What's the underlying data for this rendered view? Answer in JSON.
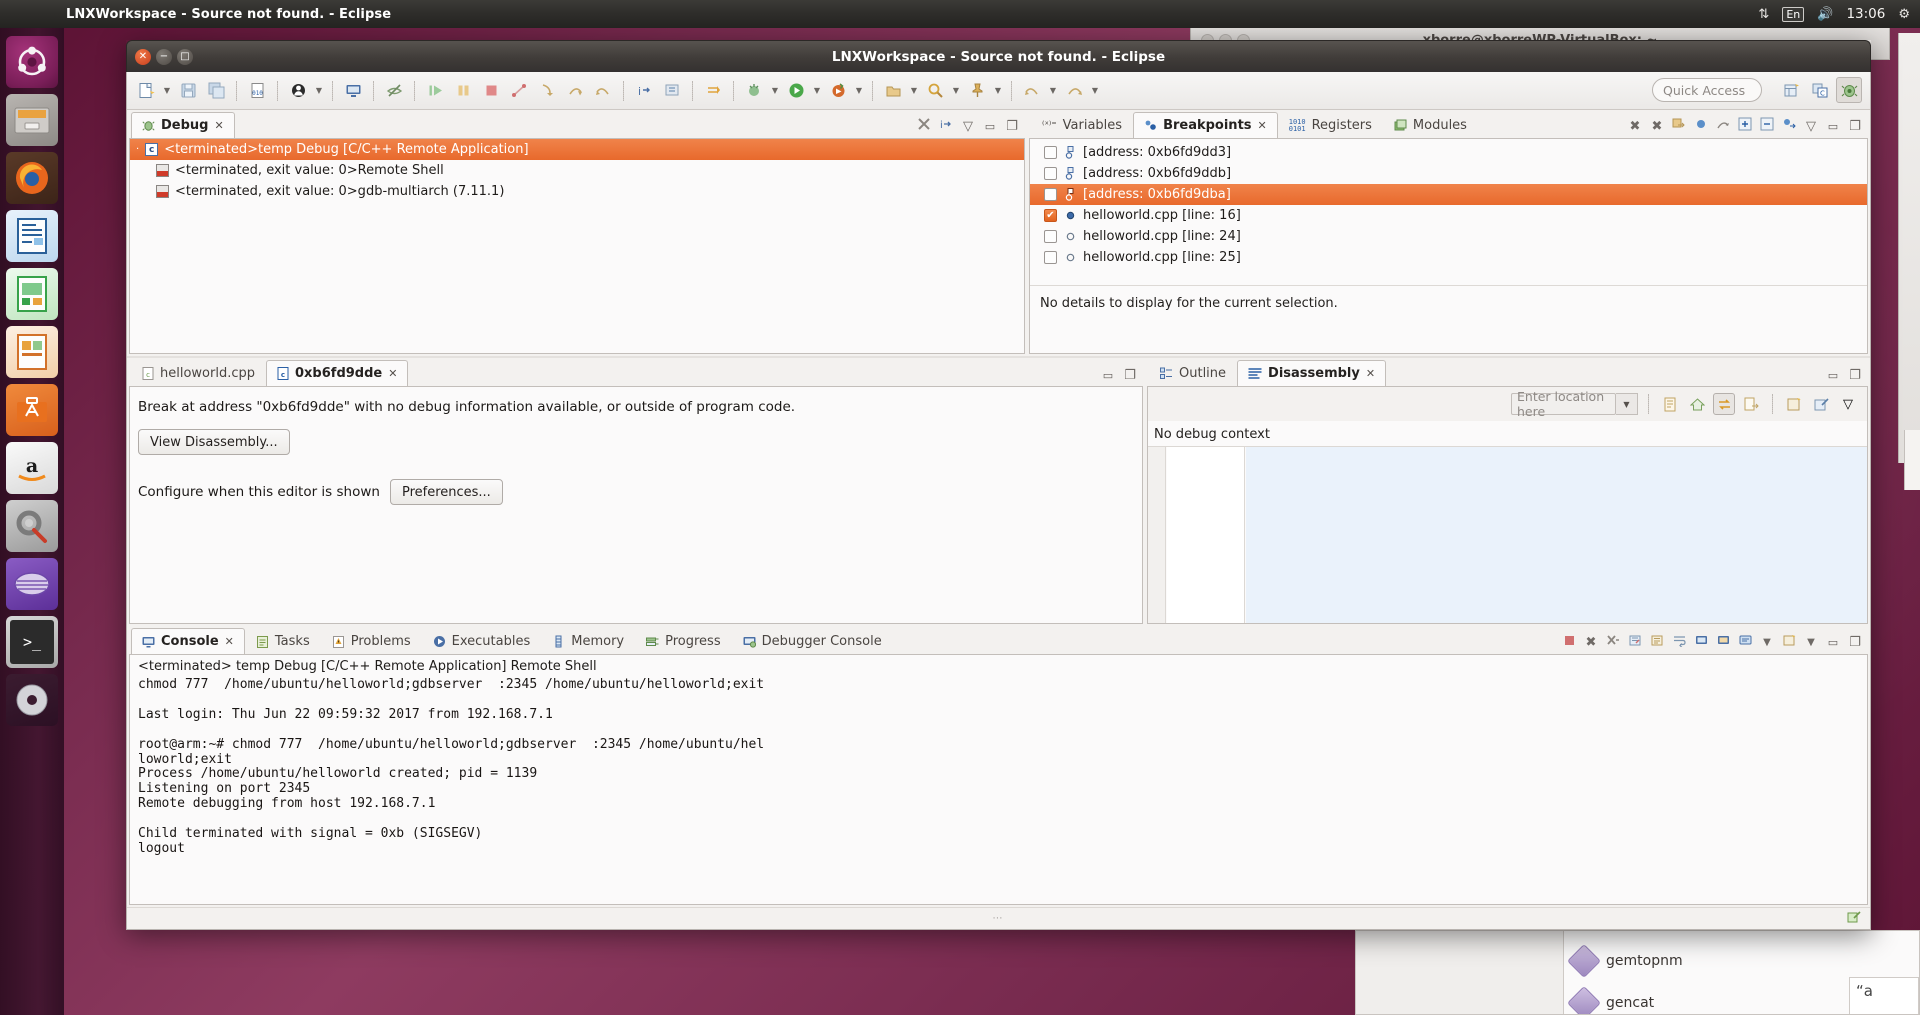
{
  "desktop": {
    "top_panel": {
      "title": "LNXWorkspace - Source not found. - Eclipse",
      "network_icon": "network-updown-icon",
      "keyboard_layout": "En",
      "volume_icon": "volume-icon",
      "clock": "13:06",
      "power_icon": "power-gear-icon"
    },
    "launcher": {
      "items": [
        {
          "name": "ubuntu-dash",
          "label": "Ubuntu Dash",
          "glyph": "ubuntu-logo-icon"
        },
        {
          "name": "files",
          "label": "Files",
          "glyph": "file-manager-icon"
        },
        {
          "name": "firefox",
          "label": "Firefox",
          "glyph": "firefox-icon"
        },
        {
          "name": "libreoffice-writer",
          "label": "LibreOffice Writer",
          "glyph": "writer-icon"
        },
        {
          "name": "libreoffice-calc",
          "label": "LibreOffice Calc",
          "glyph": "calc-icon"
        },
        {
          "name": "libreoffice-impress",
          "label": "LibreOffice Impress",
          "glyph": "impress-icon"
        },
        {
          "name": "software-center",
          "label": "Ubuntu Software",
          "glyph": "software-center-icon"
        },
        {
          "name": "amazon",
          "label": "Amazon",
          "glyph": "amazon-icon"
        },
        {
          "name": "system-settings",
          "label": "System Settings",
          "glyph": "gear-wrench-icon"
        },
        {
          "name": "eclipse",
          "label": "Eclipse",
          "glyph": "eclipse-icon"
        },
        {
          "name": "terminal",
          "label": "Terminal",
          "glyph": "terminal-icon"
        },
        {
          "name": "disc",
          "label": "Disc",
          "glyph": "cd-icon"
        }
      ]
    },
    "background_window": {
      "title": "xborre@xborreWP-VirtualBox: ~"
    },
    "bottom_list": {
      "items": [
        "gemtopnm",
        "gencat"
      ],
      "tooltip": "“a"
    }
  },
  "eclipse": {
    "window_title": "LNXWorkspace - Source not found. - Eclipse",
    "toolbar": {
      "quick_access_placeholder": "Quick Access",
      "buttons": [
        "new-file-icon",
        "dropdown-caret",
        "save-icon",
        "save-all-icon",
        "binary-file-icon",
        "skip-breakpoints-icon",
        "dropdown-caret",
        "console-icon",
        "hide-icon",
        "resume-icon",
        "suspend-icon",
        "terminate-icon",
        "disconnect-icon",
        "step-into-icon",
        "step-over-icon",
        "step-return-icon",
        "instruction-stepping-icon",
        "drop-to-frame-icon",
        "next-annotation-icon",
        "debug-run-icon",
        "dropdown-caret",
        "run-icon",
        "dropdown-caret",
        "external-tools-icon",
        "dropdown-caret",
        "open-type-icon",
        "search-icon",
        "dropdown-caret",
        "pin-icon",
        "dropdown-caret",
        "back-icon",
        "dropdown-caret",
        "forward-icon",
        "dropdown-caret"
      ],
      "perspective_buttons": [
        "open-perspective-icon",
        "cpp-perspective-icon",
        "debug-perspective-icon"
      ]
    },
    "debug_view": {
      "tab_label": "Debug",
      "tab_icon": "bug-icon",
      "tools": [
        "skip-all-breakpoints-icon",
        "instruction-step-icon",
        "view-menu-icon",
        "minimize-icon",
        "maximize-icon"
      ],
      "tree": [
        {
          "label": "<terminated>temp Debug [C/C++ Remote Application]",
          "selected": true,
          "indent": 0,
          "icon": "launch-config-icon"
        },
        {
          "label": "<terminated, exit value: 0>Remote Shell",
          "selected": false,
          "indent": 1,
          "icon": "process-icon"
        },
        {
          "label": "<terminated, exit value: 0>gdb-multiarch (7.11.1)",
          "selected": false,
          "indent": 1,
          "icon": "process-icon"
        }
      ]
    },
    "breakpoints_view": {
      "tabs": [
        {
          "label": "Variables",
          "icon": "variables-icon",
          "active": false,
          "closable": false
        },
        {
          "label": "Breakpoints",
          "icon": "breakpoint-icon",
          "active": true,
          "closable": true
        },
        {
          "label": "Registers",
          "icon": "registers-icon",
          "active": false,
          "closable": false
        },
        {
          "label": "Modules",
          "icon": "modules-icon",
          "active": false,
          "closable": false
        }
      ],
      "tools": [
        "remove-breakpoint-icon",
        "remove-all-breakpoints-icon",
        "link-with-debug-view-icon",
        "show-breakpoints-supported-icon",
        "go-to-file-icon",
        "expand-all-icon",
        "collapse-all-icon",
        "breakpoint-types-icon",
        "view-menu-icon",
        "minimize-icon",
        "maximize-icon"
      ],
      "items": [
        {
          "label": "[address: 0xb6fd9dd3]",
          "checked": false,
          "selected": false,
          "glyph": "address-breakpoint-icon"
        },
        {
          "label": "[address: 0xb6fd9ddb]",
          "checked": false,
          "selected": false,
          "glyph": "address-breakpoint-icon"
        },
        {
          "label": "[address: 0xb6fd9dba]",
          "checked": false,
          "selected": true,
          "glyph": "address-breakpoint-icon"
        },
        {
          "label": "helloworld.cpp [line: 16]",
          "checked": true,
          "selected": false,
          "glyph": "line-breakpoint-enabled-icon"
        },
        {
          "label": "helloworld.cpp [line: 24]",
          "checked": false,
          "selected": false,
          "glyph": "line-breakpoint-disabled-icon"
        },
        {
          "label": "helloworld.cpp [line: 25]",
          "checked": false,
          "selected": false,
          "glyph": "line-breakpoint-disabled-icon"
        }
      ],
      "detail_text": "No details to display for the current selection."
    },
    "editor": {
      "tabs": [
        {
          "label": "helloworld.cpp",
          "active": false,
          "closable": false,
          "icon": "cpp-file-icon"
        },
        {
          "label": "0xb6fd9dde",
          "active": true,
          "closable": true,
          "icon": "cpp-file-icon"
        }
      ],
      "tools": [
        "minimize-icon",
        "maximize-icon"
      ],
      "message": "Break at address \"0xb6fd9dde\" with no debug information available, or outside of program code.",
      "view_disassembly_button": "View Disassembly...",
      "configure_label": "Configure when this editor is shown",
      "preferences_button": "Preferences..."
    },
    "disassembly_view": {
      "tabs": [
        {
          "label": "Outline",
          "icon": "outline-icon",
          "active": false,
          "closable": false
        },
        {
          "label": "Disassembly",
          "icon": "disassembly-icon",
          "active": true,
          "closable": true
        }
      ],
      "tools": [
        "minimize-icon",
        "maximize-icon"
      ],
      "location_placeholder": "Enter location here",
      "toolbar_icons": [
        "source-icon",
        "home-icon",
        "toggle-source-icon",
        "symbols-icon",
        "new-icon",
        "edit-icon",
        "view-menu-icon"
      ],
      "status_text": "No debug context"
    },
    "console_view": {
      "tabs": [
        {
          "label": "Console",
          "icon": "console-icon",
          "active": true,
          "closable": true
        },
        {
          "label": "Tasks",
          "icon": "tasks-icon",
          "active": false,
          "closable": false
        },
        {
          "label": "Problems",
          "icon": "problems-icon",
          "active": false,
          "closable": false
        },
        {
          "label": "Executables",
          "icon": "executables-icon",
          "active": false,
          "closable": false
        },
        {
          "label": "Memory",
          "icon": "memory-icon",
          "active": false,
          "closable": false
        },
        {
          "label": "Progress",
          "icon": "progress-icon",
          "active": false,
          "closable": false
        },
        {
          "label": "Debugger Console",
          "icon": "debugger-console-icon",
          "active": false,
          "closable": false
        }
      ],
      "tools": [
        "terminate-icon",
        "remove-launch-icon",
        "remove-all-terminated-icon",
        "clear-console-icon",
        "scroll-lock-icon",
        "word-wrap-icon",
        "show-console-on-output-icon",
        "pin-console-icon",
        "display-selected-console-icon",
        "dropdown-caret",
        "open-console-icon",
        "dropdown-caret",
        "minimize-icon",
        "maximize-icon"
      ],
      "header": "<terminated> temp Debug [C/C++ Remote Application] Remote Shell",
      "output": "chmod 777  /home/ubuntu/helloworld;gdbserver  :2345 /home/ubuntu/helloworld;exit\n\nLast login: Thu Jun 22 09:59:32 2017 from 192.168.7.1\n\nroot@arm:~# chmod 777  /home/ubuntu/helloworld;gdbserver  :2345 /home/ubuntu/hel\nloworld;exit\nProcess /home/ubuntu/helloworld created; pid = 1139\nListening on port 2345\nRemote debugging from host 192.168.7.1\n\nChild terminated with signal = 0xb (SIGSEGV)\nlogout"
    },
    "statusbar": {
      "drag_handle": "⋯",
      "right_icon": "writable-indicator-icon"
    }
  },
  "colors": {
    "selection_orange": "#e8692c",
    "ubuntu_purple": "#2c001e",
    "panel_bg": "#f3f1ef",
    "accent_blue": "#3c6aa8"
  }
}
